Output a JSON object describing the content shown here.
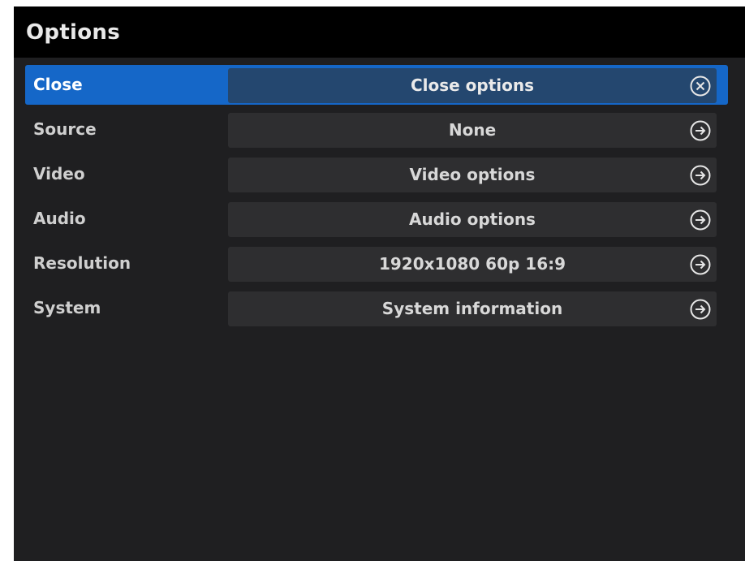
{
  "window": {
    "title": "Options"
  },
  "menu": {
    "items": [
      {
        "label": "Close",
        "value": "Close options",
        "icon": "close-circle-icon",
        "selected": true
      },
      {
        "label": "Source",
        "value": "None",
        "icon": "arrow-right-circle-icon",
        "selected": false
      },
      {
        "label": "Video",
        "value": "Video options",
        "icon": "arrow-right-circle-icon",
        "selected": false
      },
      {
        "label": "Audio",
        "value": "Audio options",
        "icon": "arrow-right-circle-icon",
        "selected": false
      },
      {
        "label": "Resolution",
        "value": "1920x1080 60p 16:9",
        "icon": "arrow-right-circle-icon",
        "selected": false
      },
      {
        "label": "System",
        "value": "System information",
        "icon": "arrow-right-circle-icon",
        "selected": false
      }
    ]
  },
  "colors": {
    "background": "#1f1f21",
    "titlebar": "#000000",
    "selected_row": "#1567c8",
    "field": "#2e2e30",
    "selected_field": "#24476f",
    "text": "#d8d8d8"
  }
}
